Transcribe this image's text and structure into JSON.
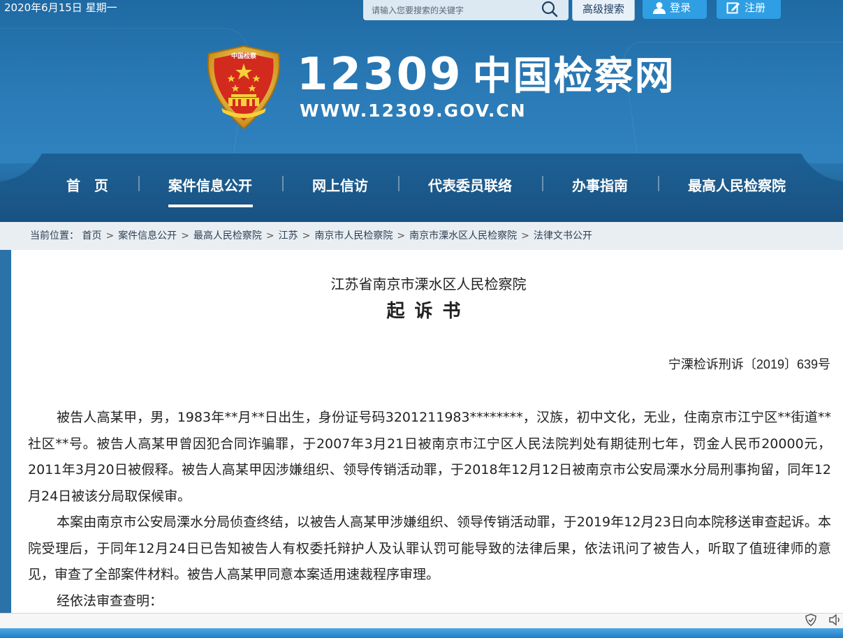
{
  "topbar": {
    "date": "2020年6月15日 星期一",
    "search_placeholder": "请输入您要搜索的关键字",
    "advanced_search": "高级搜索",
    "login": "登录",
    "register": "注册"
  },
  "site": {
    "emblem_top_text": "中国检察",
    "title_number": "12309",
    "title_chinese": "中国检察网",
    "url": "WWW.12309.GOV.CN"
  },
  "nav": {
    "items": [
      {
        "label": "首　页"
      },
      {
        "label": "案件信息公开"
      },
      {
        "label": "网上信访"
      },
      {
        "label": "代表委员联络"
      },
      {
        "label": "办事指南"
      },
      {
        "label": "最高人民检察院"
      }
    ],
    "active_index": 1
  },
  "breadcrumb": {
    "prefix": "当前位置：",
    "items": [
      "首页",
      "案件信息公开",
      "最高人民检察院",
      "江苏",
      "南京市人民检察院",
      "南京市溧水区人民检察院",
      "法律文书公开"
    ],
    "separator": ">"
  },
  "document": {
    "organization": "江苏省南京市溧水区人民检察院",
    "type": "起诉书",
    "number": "宁溧检诉刑诉〔2019〕639号",
    "paragraphs": [
      "被告人高某甲，男，1983年**月**日出生，身份证号码3201211983********，汉族，初中文化，无业，住南京市江宁区**街道**社区**号。被告人高某甲曾因犯合同诈骗罪，于2007年3月21日被南京市江宁区人民法院判处有期徒刑七年，罚金人民币20000元，2011年3月20日被假释。被告人高某甲因涉嫌组织、领导传销活动罪，于2018年12月12日被南京市公安局溧水分局刑事拘留，同年12月24日被该分局取保候审。",
      "本案由南京市公安局溧水分局侦查终结，以被告人高某甲涉嫌组织、领导传销活动罪，于2019年12月23日向本院移送审查起诉。本院受理后，于同年12月24日已告知被告人有权委托辩护人及认罪认罚可能导致的法律后果，依法讯问了被告人，听取了值班律师的意见，审查了全部案件材料。被告人高某甲同意本案适用速裁程序审理。",
      "经依法审查查明："
    ]
  },
  "colors": {
    "header_blue": "#2a7ab6",
    "button_blue": "#2f9ee3",
    "emblem_red": "#d32a1e",
    "emblem_gold": "#e8b52a"
  }
}
